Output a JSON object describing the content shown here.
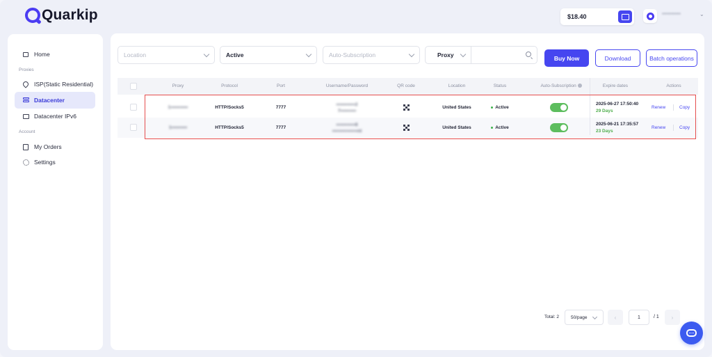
{
  "app": {
    "brand": "Quarkip"
  },
  "topbar": {
    "balance": "$18.40",
    "user_name": "•••••••••••"
  },
  "sidebar": {
    "items": [
      {
        "label": "Home",
        "icon": "home-icon"
      },
      {
        "label": "ISP(Static Residential)",
        "icon": "location-pin-icon"
      },
      {
        "label": "Datacenter",
        "icon": "server-icon",
        "active": true
      },
      {
        "label": "Datacenter IPv6",
        "icon": "monitor-icon"
      },
      {
        "label": "My Orders",
        "icon": "orders-icon"
      },
      {
        "label": "Settings",
        "icon": "gear-icon"
      }
    ],
    "sections": {
      "proxies": "Proxies",
      "account": "Account"
    }
  },
  "filters": {
    "location_placeholder": "Location",
    "status_value": "Active",
    "auto_sub_placeholder": "Auto-Subscription",
    "search_type": "Proxy",
    "search_placeholder": ""
  },
  "buttons": {
    "buy_now": "Buy Now",
    "download": "Download",
    "batch": "Batch operations"
  },
  "table": {
    "headers": {
      "proxy": "Proxy",
      "protocol": "Protocol",
      "port": "Port",
      "credentials": "Username/Password",
      "qr": "QR code",
      "location": "Location",
      "status": "Status",
      "auto_sub": "Auto-Subscription",
      "expire": "Expire dates",
      "actions": "Actions"
    },
    "rows": [
      {
        "proxy": "1•••••••••••",
        "protocol": "HTTP/Socks5",
        "port": "7777",
        "cred_line1": "••••••••••••2",
        "cred_line2": "7••••••••••",
        "location": "United States",
        "status": "Active",
        "auto_sub_on": true,
        "expire_date": "2025-06-27 17:50:40",
        "expire_days": "29 Days",
        "renew": "Renew",
        "copy": "Copy"
      },
      {
        "proxy": "1••••••••••",
        "protocol": "HTTP/Socks5",
        "port": "7777",
        "cred_line1": "••••••••••••8",
        "cred_line2": "••••••••••••••••nt",
        "location": "United States",
        "status": "Active",
        "auto_sub_on": true,
        "expire_date": "2025-06-21 17:35:57",
        "expire_days": "23 Days",
        "renew": "Renew",
        "copy": "Copy"
      }
    ]
  },
  "pagination": {
    "total": "Total: 2",
    "page_size": "50/page",
    "current": "1",
    "of": "/ 1"
  },
  "colors": {
    "accent": "#4646f0",
    "active": "#3eb24d",
    "highlight": "#e54d4d"
  }
}
